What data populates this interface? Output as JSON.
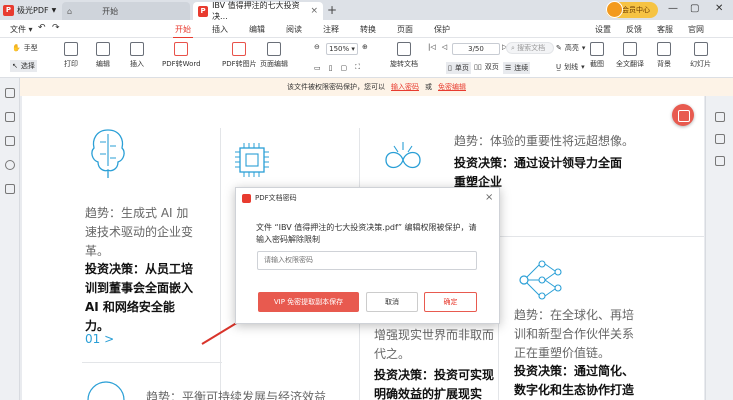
{
  "app": {
    "name": "极光PDF"
  },
  "tabs": [
    {
      "label": "开始"
    },
    {
      "label": "IBV 值得押注的七大投资决..."
    }
  ],
  "member": {
    "label": "会员中心"
  },
  "menu": {
    "file": "文件",
    "items": [
      "开始",
      "插入",
      "编辑",
      "阅读",
      "注释",
      "转换",
      "页面",
      "保护"
    ],
    "right": [
      "设置",
      "反馈",
      "客服",
      "官网"
    ]
  },
  "toolbar": {
    "hand": "手型",
    "select": "选择",
    "print": "打印",
    "edit": "编辑",
    "insert": "插入",
    "pdf_to_word": "PDF转Word",
    "pdf_to_image": "PDF转图片",
    "page_edit": "页面编辑",
    "zoom": "150%",
    "rotate": "旋转文档",
    "single": "单页",
    "double": "双页",
    "continuous": "连续",
    "page": "3/50",
    "search_placeholder": "搜索文档",
    "highlight": "高亮",
    "underline": "划线",
    "screenshot": "截图",
    "full_translate": "全文翻译",
    "background": "背景",
    "slideshow": "幻灯片"
  },
  "notice": {
    "text": "该文件被权限密码保护，您可以",
    "link1": "输入密码",
    "mid": "或",
    "link2": "免密编辑"
  },
  "doc": {
    "col1": {
      "trend": "趋势：生成式 AI 加速技术驱动的企业变革。",
      "decision": "投资决策：从员工培训到董事会全面嵌入 AI 和网络安全能力。",
      "num": "01 >"
    },
    "col3_top": {
      "trend": "趋势：体验的重要性将远超想像。",
      "decision": "投资决策：通过设计领导力全面重塑企业"
    },
    "col3_bottom": {
      "trend": "增强现实世界而非取而代之。",
      "decision": "投资决策：投资可实现明确效益的扩展现实"
    },
    "col4": {
      "trend": "趋势：在全球化、再培训和新型合作伙伴关系正在重塑价值链。",
      "decision": "投资决策：通过简化、数字化和生态协作打造弹"
    },
    "bottom_left": "趋势：平衡可持续发展与经济效益"
  },
  "dialog": {
    "title": "PDF文档密码",
    "message": "文件 “IBV 值得押注的七大投资决策.pdf” 编辑权限被保护，请输入密码解除限制",
    "placeholder": "请输入权限密码",
    "free_label": "VIP 免密提取副本保存",
    "cancel": "取消",
    "ok": "确定"
  }
}
